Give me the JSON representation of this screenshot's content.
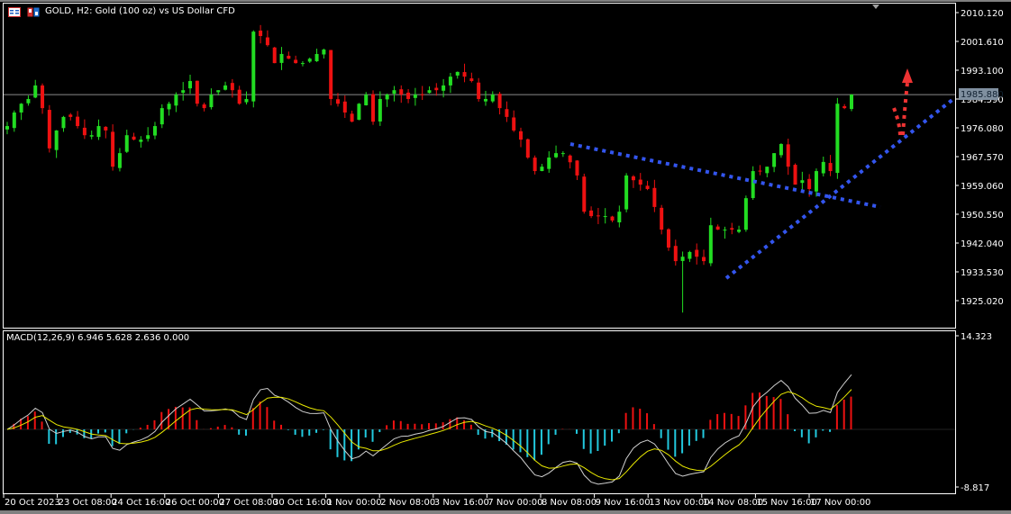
{
  "header": {
    "title": "GOLD, H2:  Gold (100 oz) vs US Dollar CFD",
    "icons": [
      "trade-panel-icon",
      "depth-of-market-icon"
    ]
  },
  "colors": {
    "background": "#000000",
    "bull": "#22dd22",
    "bear": "#ee1111",
    "hist_pos": "#ee1111",
    "hist_neg": "#22c8dd",
    "macd_line": "#d0d0d0",
    "signal_line": "#e8e800",
    "trendline": "#3355ee",
    "arrow": "#ee3333",
    "price_tag": "#8090a0"
  },
  "macd": {
    "label": "MACD(12,26,9) 6.946 5.628 2.636 0.000",
    "axis_max": "14.323",
    "axis_min": "-8.817"
  },
  "chart_data": {
    "type": "candlestick",
    "symbol": "GOLD",
    "timeframe": "H2",
    "ylim": [
      1921.0,
      2012.0
    ],
    "current_price": "1985.880",
    "y_ticks": [
      "2010.120",
      "2001.610",
      "1993.100",
      "1984.590",
      "1976.080",
      "1967.570",
      "1959.060",
      "1950.550",
      "1942.040",
      "1933.530",
      "1925.020"
    ],
    "x_ticks": [
      "20 Oct 2023",
      "23 Oct 08:00",
      "24 Oct 16:00",
      "26 Oct 00:00",
      "27 Oct 08:00",
      "30 Oct 16:00",
      "1 Nov 00:00",
      "2 Nov 08:00",
      "3 Nov 16:00",
      "7 Nov 00:00",
      "8 Nov 08:00",
      "9 Nov 16:00",
      "13 Nov 00:00",
      "14 Nov 08:00",
      "15 Nov 16:00",
      "17 Nov 00:00"
    ],
    "closes": [
      1976.6,
      1980.6,
      1983.2,
      1984.6,
      1988.6,
      1981.9,
      1970.0,
      1975.3,
      1979.3,
      1979.3,
      1976.6,
      1973.9,
      1973.9,
      1976.6,
      1975.3,
      1964.6,
      1968.6,
      1973.9,
      1972.6,
      1972.6,
      1973.9,
      1976.6,
      1981.9,
      1983.2,
      1985.9,
      1987.2,
      1989.9,
      1983.2,
      1981.9,
      1985.9,
      1987.2,
      1988.6,
      1987.2,
      1983.2,
      1984.6,
      2004.5,
      2003.2,
      2000.5,
      1995.2,
      1997.9,
      1996.5,
      1995.2,
      1995.2,
      1996.5,
      1997.9,
      1999.2,
      1984.6,
      1983.2,
      1980.6,
      1977.9,
      1983.2,
      1985.9,
      1977.9,
      1984.6,
      1985.9,
      1987.2,
      1985.9,
      1984.6,
      1985.9,
      1985.9,
      1987.2,
      1987.2,
      1988.6,
      1991.2,
      1992.6,
      1991.2,
      1989.9,
      1984.6,
      1984.6,
      1985.9,
      1981.9,
      1979.3,
      1975.3,
      1972.6,
      1967.3,
      1963.3,
      1964.6,
      1967.3,
      1968.6,
      1968.6,
      1965.9,
      1962.0,
      1951.3,
      1950.0,
      1950.0,
      1950.0,
      1948.7,
      1951.3,
      1962.0,
      1960.6,
      1959.3,
      1958.0,
      1952.7,
      1946.0,
      1940.7,
      1936.7,
      1938.0,
      1939.4,
      1938.0,
      1936.7,
      1947.3,
      1946.0,
      1946.0,
      1946.0,
      1946.0,
      1955.3,
      1963.3,
      1963.3,
      1964.6,
      1968.6,
      1971.3,
      1964.6,
      1959.3,
      1960.6,
      1958.0,
      1963.3,
      1966.0,
      1963.3,
      1983.2,
      1981.9,
      1985.9
    ]
  }
}
